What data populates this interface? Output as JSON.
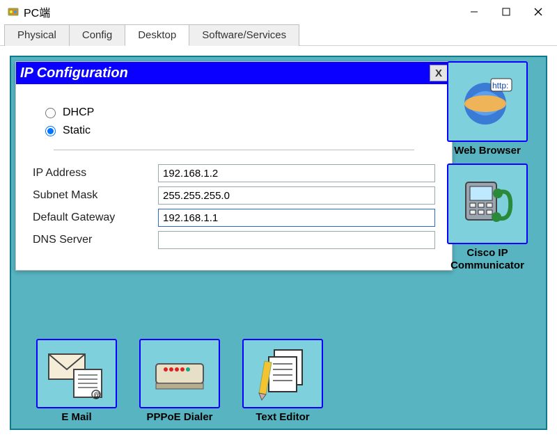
{
  "window": {
    "title": "PC端"
  },
  "tabs": [
    {
      "label": "Physical"
    },
    {
      "label": "Config"
    },
    {
      "label": "Desktop"
    },
    {
      "label": "Software/Services"
    }
  ],
  "ipconfig": {
    "title": "IP Configuration",
    "close_label": "X",
    "radios": {
      "dhcp": "DHCP",
      "static": "Static",
      "selected": "static"
    },
    "fields": {
      "ip_label": "IP Address",
      "ip_value": "192.168.1.2",
      "subnet_label": "Subnet Mask",
      "subnet_value": "255.255.255.0",
      "gateway_label": "Default Gateway",
      "gateway_value": "192.168.1.1",
      "dns_label": "DNS Server",
      "dns_value": ""
    }
  },
  "apps_right": [
    {
      "label": "Web Browser",
      "icon": "web-browser-icon"
    },
    {
      "label": "Cisco IP Communicator",
      "icon": "ip-phone-icon"
    }
  ],
  "apps_bottom": [
    {
      "label": "E Mail",
      "icon": "email-icon"
    },
    {
      "label": "PPPoE Dialer",
      "icon": "modem-icon"
    },
    {
      "label": "Text Editor",
      "icon": "text-editor-icon"
    }
  ]
}
